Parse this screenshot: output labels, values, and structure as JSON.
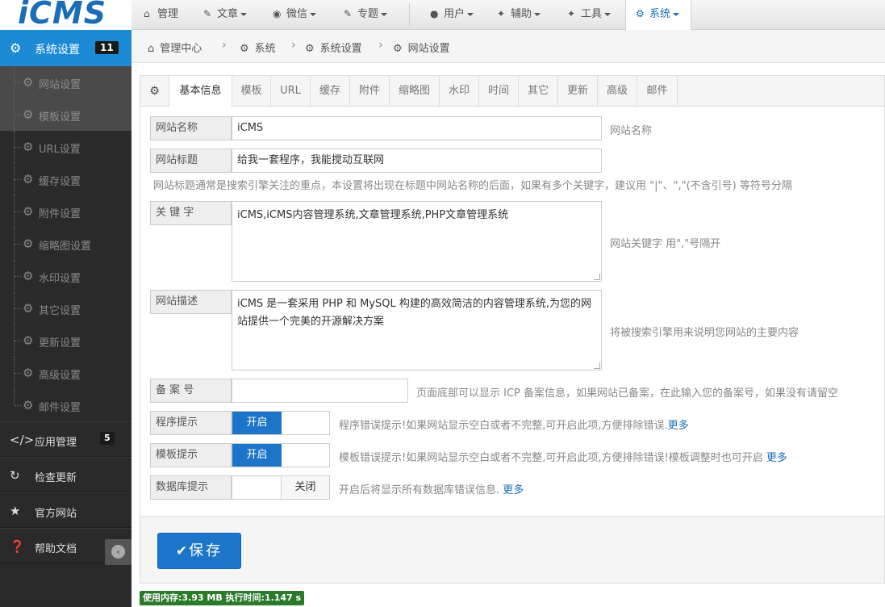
{
  "logo": {
    "text": "iCMS"
  },
  "topnav": [
    {
      "icon": "home-icon",
      "label": "管理",
      "caret": false
    },
    {
      "icon": "edit-icon",
      "label": "文章",
      "caret": true
    },
    {
      "icon": "wechat-icon",
      "label": "微信",
      "caret": true
    },
    {
      "icon": "edit-icon",
      "label": "专题",
      "caret": true
    },
    {
      "icon": "user-icon",
      "label": "用户",
      "caret": true
    },
    {
      "icon": "wrench-icon",
      "label": "辅助",
      "caret": true
    },
    {
      "icon": "wrench-icon",
      "label": "工具",
      "caret": true
    },
    {
      "icon": "gear-icon",
      "label": "系统",
      "caret": true
    }
  ],
  "sidebar": {
    "head": {
      "label": "系统设置",
      "badge": "11"
    },
    "subitems": [
      {
        "label": "网站设置"
      },
      {
        "label": "模板设置"
      },
      {
        "label": "URL设置"
      },
      {
        "label": "缓存设置"
      },
      {
        "label": "附件设置"
      },
      {
        "label": "缩略图设置"
      },
      {
        "label": "水印设置"
      },
      {
        "label": "其它设置"
      },
      {
        "label": "更新设置"
      },
      {
        "label": "高级设置"
      },
      {
        "label": "邮件设置"
      }
    ],
    "items": [
      {
        "icon": "code-icon",
        "label": "应用管理",
        "badge": "5"
      },
      {
        "icon": "refresh-icon",
        "label": "检查更新"
      },
      {
        "icon": "star-icon",
        "label": "官方网站"
      },
      {
        "icon": "question-icon",
        "label": "帮助文档"
      }
    ]
  },
  "breadcrumb": [
    "管理中心",
    "系统",
    "系统设置",
    "网站设置"
  ],
  "tabs": [
    "基本信息",
    "模板",
    "URL",
    "缓存",
    "附件",
    "缩略图",
    "水印",
    "时间",
    "其它",
    "更新",
    "高级",
    "邮件"
  ],
  "form": {
    "site_name": {
      "label": "网站名称",
      "value": "iCMS",
      "help": "网站名称"
    },
    "site_title": {
      "label": "网站标题",
      "value": "给我一套程序，我能搅动互联网",
      "help": "网站标题通常是搜索引擎关注的重点，本设置将出现在标题中网站名称的后面，如果有多个关键字，建议用 \"|\"、\",\"(不含引号) 等符号分隔"
    },
    "keywords": {
      "label": "关 键 字",
      "value": "iCMS,iCMS内容管理系统,文章管理系统,PHP文章管理系统",
      "help": "网站关键字 用\",\"号隔开"
    },
    "description": {
      "label": "网站描述",
      "value": "iCMS 是一套采用 PHP 和 MySQL 构建的高效简洁的内容管理系统,为您的网站提供一个完美的开源解决方案",
      "help": "将被搜索引擎用来说明您网站的主要内容"
    },
    "icp": {
      "label": "备 案 号",
      "value": "",
      "help": "页面底部可以显示 ICP 备案信息，如果网站已备案，在此输入您的备案号，如果没有请留空"
    },
    "program_hint": {
      "label": "程序提示",
      "state": "开启",
      "help": "程序错误提示!如果网站显示空白或者不完整,可开启此项,方便排除错误.",
      "more": "更多"
    },
    "template_hint": {
      "label": "模板提示",
      "state": "开启",
      "help": "模板错误提示!如果网站显示空白或者不完整,可开启此项,方便排除错误!模板调整时也可开启",
      "more": "更多"
    },
    "db_hint": {
      "label": "数据库提示",
      "state": "关闭",
      "help": "开启后将显示所有数据库错误信息.",
      "more": "更多"
    }
  },
  "save_label": "保存",
  "status": "使用内存:3.93 MB 执行时间:1.147 s",
  "colors": {
    "accent": "#1d75c9",
    "sidebar_bg": "#2a2a2a",
    "sidebar_active": "#1d8ad6",
    "status_bg": "#2b7a2b"
  }
}
